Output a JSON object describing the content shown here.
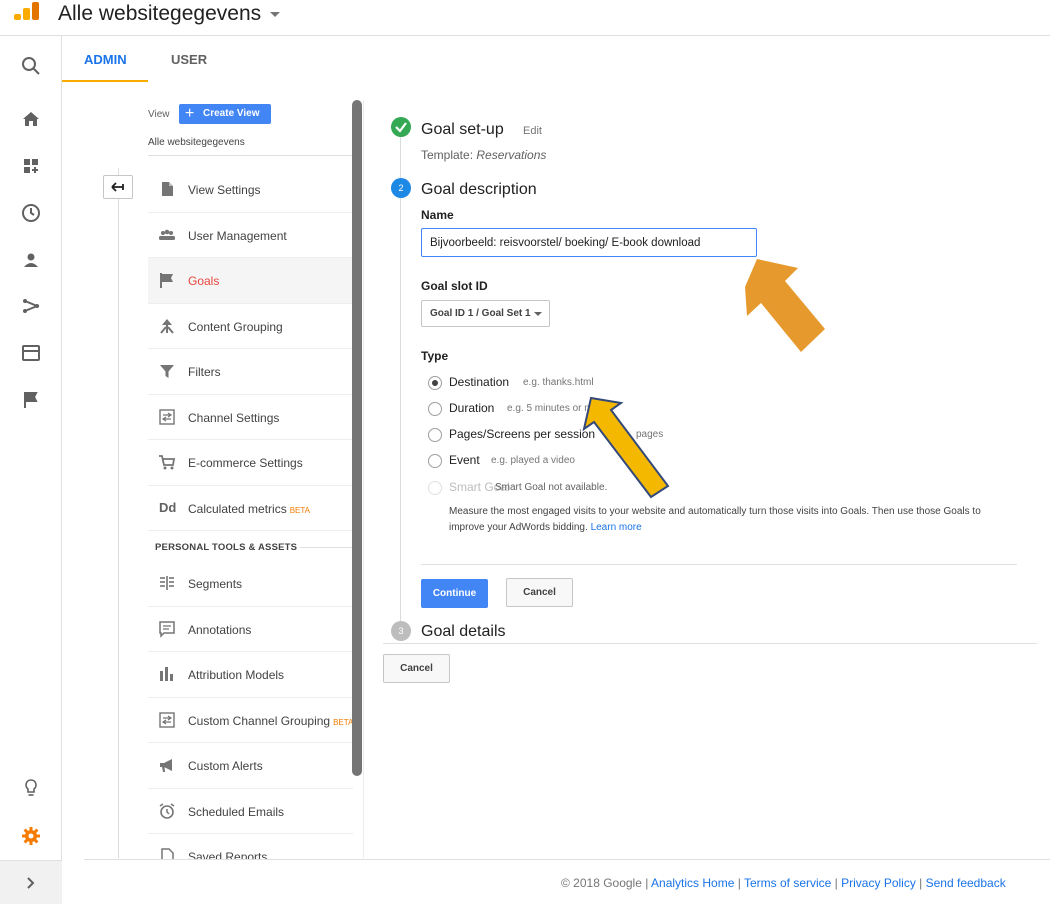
{
  "header": {
    "account_title": "Alle websitegegevens"
  },
  "tabs": {
    "admin": "ADMIN",
    "user": "USER"
  },
  "view": {
    "label": "View",
    "create_button": "Create View",
    "name": "Alle websitegegevens"
  },
  "menu": {
    "items": [
      {
        "label": "View Settings",
        "icon": "document-icon"
      },
      {
        "label": "User Management",
        "icon": "users-icon"
      },
      {
        "label": "Goals",
        "icon": "flag-icon",
        "active": true
      },
      {
        "label": "Content Grouping",
        "icon": "content-grouping-icon"
      },
      {
        "label": "Filters",
        "icon": "filter-icon"
      },
      {
        "label": "Channel Settings",
        "icon": "channel-icon"
      },
      {
        "label": "E-commerce Settings",
        "icon": "cart-icon"
      },
      {
        "label": "Calculated metrics",
        "badge": "BETA",
        "icon": "dd-icon"
      }
    ],
    "section_title": "PERSONAL TOOLS & ASSETS",
    "personal_items": [
      {
        "label": "Segments",
        "icon": "segments-icon"
      },
      {
        "label": "Annotations",
        "icon": "annotations-icon"
      },
      {
        "label": "Attribution Models",
        "icon": "attribution-icon"
      },
      {
        "label": "Custom Channel Grouping",
        "badge": "BETA",
        "icon": "channel-icon"
      },
      {
        "label": "Custom Alerts",
        "icon": "megaphone-icon"
      },
      {
        "label": "Scheduled Emails",
        "icon": "clock-icon"
      },
      {
        "label": "Saved Reports",
        "icon": "document-icon"
      }
    ]
  },
  "goal": {
    "step1_title": "Goal set-up",
    "step1_edit": "Edit",
    "template_label": "Template:",
    "template_value": "Reservations",
    "step2_number": "2",
    "step2_title": "Goal description",
    "name_label": "Name",
    "name_value": "Bijvoorbeeld: reisvoorstel/ boeking/ E-book download",
    "slot_label": "Goal slot ID",
    "slot_value": "Goal ID 1 / Goal Set 1",
    "type_label": "Type",
    "types": [
      {
        "label": "Destination",
        "hint": "e.g. thanks.html",
        "checked": true
      },
      {
        "label": "Duration",
        "hint": "e.g. 5 minutes or m"
      },
      {
        "label": "Pages/Screens per session",
        "hint": "pages"
      },
      {
        "label": "Event",
        "hint": "e.g. played a video"
      },
      {
        "label": "Smart Goal",
        "hint": "Smart Goal not available.",
        "disabled": true
      }
    ],
    "smart_description": "Measure the most engaged visits to your website and automatically turn those visits into Goals. Then use those Goals to improve your AdWords bidding.",
    "learn_more": "Learn more",
    "continue_button": "Continue",
    "cancel_button": "Cancel",
    "step3_number": "3",
    "step3_title": "Goal details",
    "outer_cancel_button": "Cancel"
  },
  "footer": {
    "copyright": "© 2018 Google |",
    "links": [
      "Analytics Home",
      "Terms of service",
      "Privacy Policy",
      "Send feedback"
    ]
  },
  "colors": {
    "accent": "#4285f4",
    "admin_tab_underline": "#f9ab00",
    "active_menu": "#e8453c",
    "annotation_arrow": "#e69a2e"
  }
}
